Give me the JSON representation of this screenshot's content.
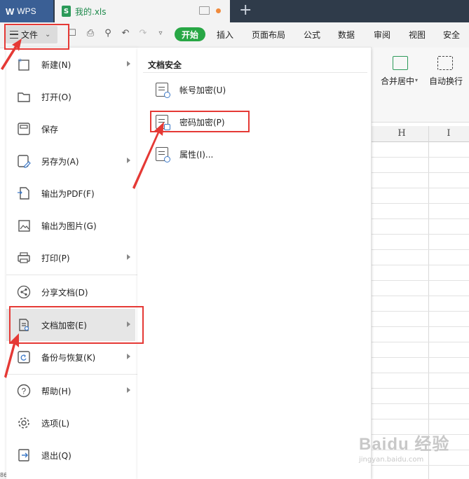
{
  "titlebar": {
    "app_tab": "WPS",
    "doc_tab": "我的.xls"
  },
  "toolbar": {
    "file_label": "文件",
    "tabs": [
      "开始",
      "插入",
      "页面布局",
      "公式",
      "数据",
      "审阅",
      "视图",
      "安全"
    ],
    "active_tab": "开始"
  },
  "ribbon": {
    "merge_label": "合并居中",
    "wrap_label": "自动换行"
  },
  "sheet": {
    "columns": [
      "H",
      "I"
    ],
    "row_label": "86"
  },
  "file_menu": {
    "items": [
      {
        "label": "新建(N)",
        "icon": "new-file-icon",
        "submenu": true
      },
      {
        "label": "打开(O)",
        "icon": "folder-icon",
        "submenu": false
      },
      {
        "label": "保存",
        "icon": "save-icon",
        "submenu": false
      },
      {
        "label": "另存为(A)",
        "icon": "save-as-icon",
        "submenu": true
      },
      {
        "label": "输出为PDF(F)",
        "icon": "pdf-icon",
        "submenu": false
      },
      {
        "label": "输出为图片(G)",
        "icon": "image-icon",
        "submenu": false
      },
      {
        "label": "打印(P)",
        "icon": "printer-icon",
        "submenu": true
      },
      {
        "label": "分享文档(D)",
        "icon": "share-icon",
        "submenu": false
      },
      {
        "label": "文档加密(E)",
        "icon": "doc-encrypt-icon",
        "submenu": true
      },
      {
        "label": "备份与恢复(K)",
        "icon": "backup-icon",
        "submenu": true
      },
      {
        "label": "帮助(H)",
        "icon": "help-icon",
        "submenu": true
      },
      {
        "label": "选项(L)",
        "icon": "gear-icon",
        "submenu": false
      },
      {
        "label": "退出(Q)",
        "icon": "exit-icon",
        "submenu": false
      }
    ],
    "highlighted": "文档加密(E)"
  },
  "security_submenu": {
    "title": "文档安全",
    "items": [
      {
        "label": "帐号加密(U)",
        "icon": "account-lock-icon"
      },
      {
        "label": "密码加密(P)",
        "icon": "password-lock-icon"
      },
      {
        "label": "属性(I)...",
        "icon": "properties-icon"
      }
    ]
  },
  "watermark": {
    "text": "Baidu 经验",
    "subtext": "jingyan.baidu.com"
  },
  "colors": {
    "accent_green": "#28a745",
    "annotation_red": "#e53935",
    "titlebar": "#2f3b4a",
    "wps_blue": "#3a5f95"
  }
}
